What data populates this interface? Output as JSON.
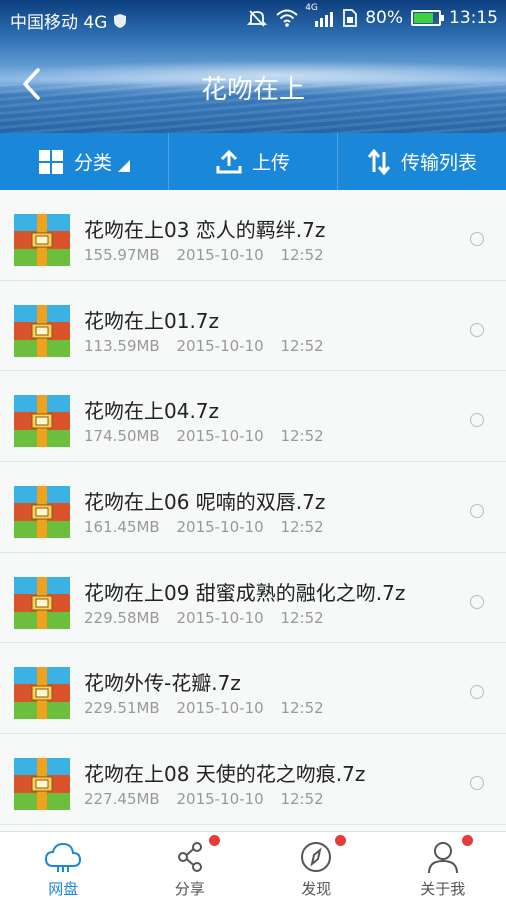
{
  "status_bar": {
    "carrier": "中国移动 4G",
    "network": "4G",
    "battery": "80%",
    "battery_level": 0.8,
    "time": "13:15"
  },
  "header": {
    "title": "花吻在上",
    "back_icon": "chevron-left-icon"
  },
  "toolbar": {
    "category_label": "分类",
    "upload_label": "上传",
    "transfer_label": "传输列表"
  },
  "files": [
    {
      "name": "花吻在上03 恋人的羁绊.7z",
      "size": "155.97MB",
      "date": "2015-10-10",
      "time": "12:52"
    },
    {
      "name": "花吻在上01.7z",
      "size": "113.59MB",
      "date": "2015-10-10",
      "time": "12:52"
    },
    {
      "name": "花吻在上04.7z",
      "size": "174.50MB",
      "date": "2015-10-10",
      "time": "12:52"
    },
    {
      "name": "花吻在上06 呢喃的双唇.7z",
      "size": "161.45MB",
      "date": "2015-10-10",
      "time": "12:52"
    },
    {
      "name": "花吻在上09 甜蜜成熟的融化之吻.7z",
      "size": "229.58MB",
      "date": "2015-10-10",
      "time": "12:52"
    },
    {
      "name": "花吻外传-花瓣.7z",
      "size": "229.51MB",
      "date": "2015-10-10",
      "time": "12:52"
    },
    {
      "name": "花吻在上08 天使的花之吻痕.7z",
      "size": "227.45MB",
      "date": "2015-10-10",
      "time": "12:52"
    }
  ],
  "tabs": [
    {
      "label": "网盘",
      "icon": "cloud-icon",
      "active": true,
      "badge": false
    },
    {
      "label": "分享",
      "icon": "share-icon",
      "active": false,
      "badge": true
    },
    {
      "label": "发现",
      "icon": "compass-icon",
      "active": false,
      "badge": true
    },
    {
      "label": "关于我",
      "icon": "user-icon",
      "active": false,
      "badge": true
    }
  ],
  "colors": {
    "accent": "#1b87d9",
    "badge": "#e83a3a",
    "battery_fill": "#3fd23f"
  }
}
